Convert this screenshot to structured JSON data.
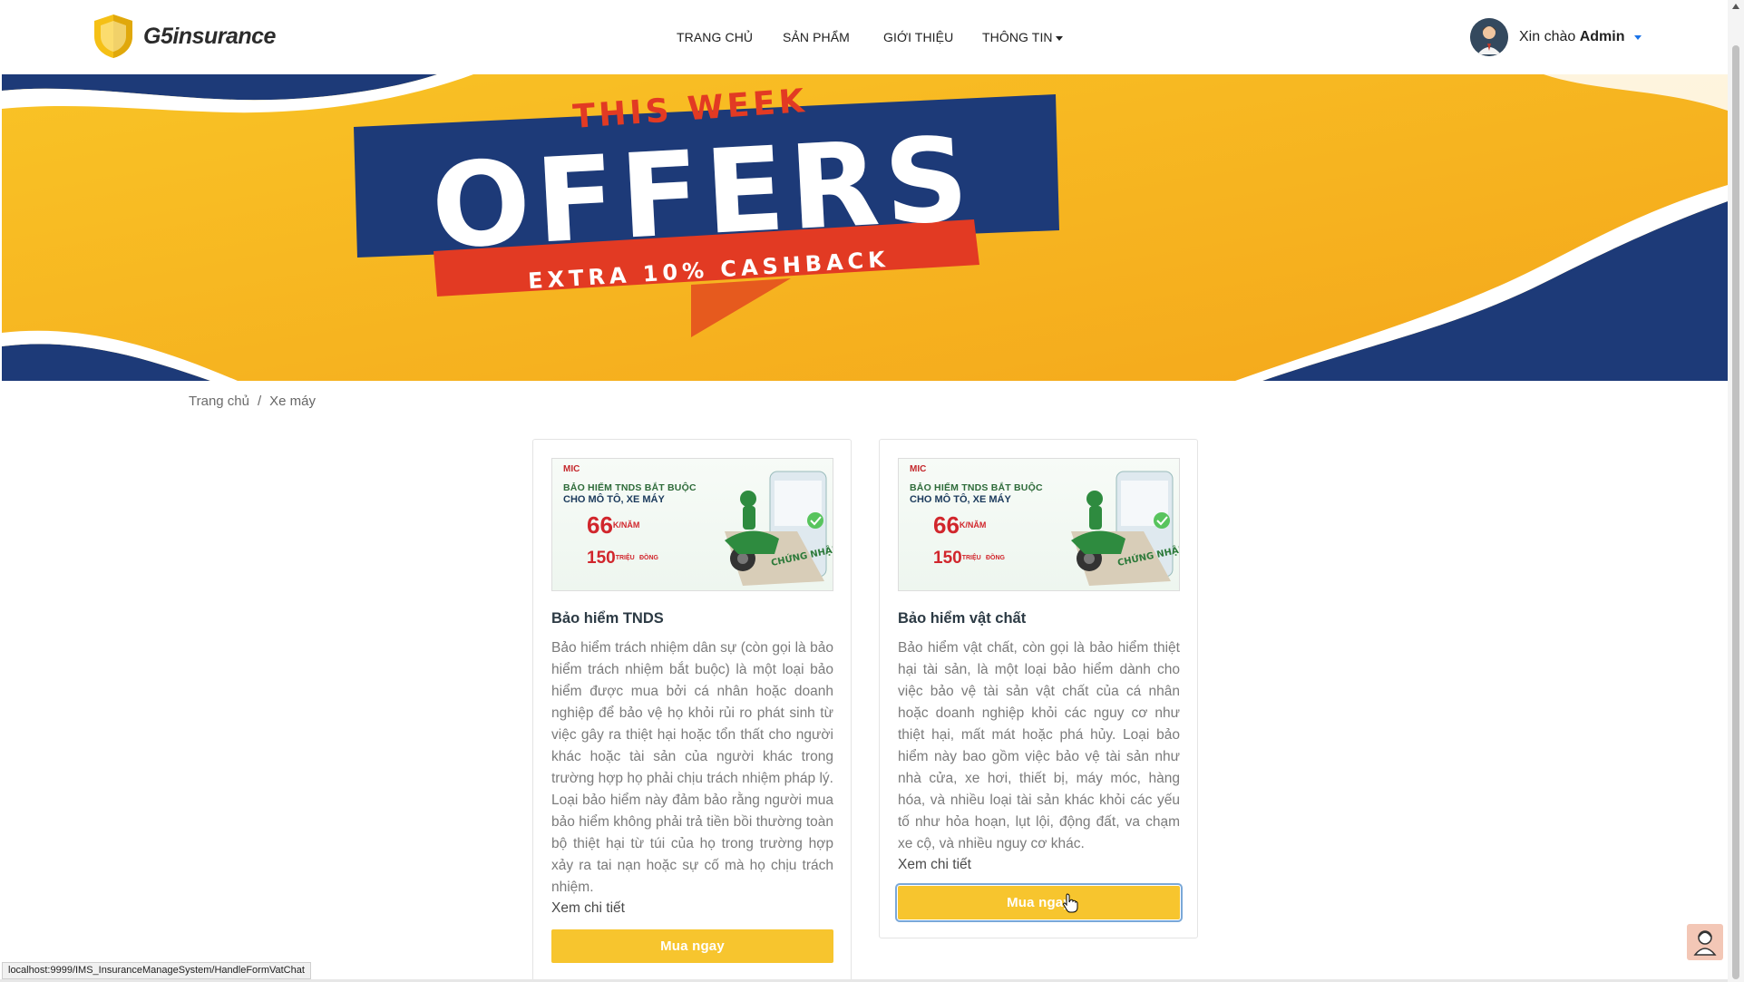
{
  "brand": {
    "name": "G5insurance"
  },
  "nav": {
    "items": [
      {
        "label": "TRANG CHỦ"
      },
      {
        "label": "SẢN PHẨM"
      },
      {
        "label": "GIỚI THIỆU"
      },
      {
        "label": "THÔNG TIN"
      }
    ]
  },
  "user": {
    "greeting": "Xin chào",
    "name": "Admin"
  },
  "banner": {
    "line1": "THIS WEEK",
    "line2": "OFFERS",
    "line3": "EXTRA 10% CASHBACK"
  },
  "breadcrumb": {
    "home": "Trang chủ",
    "separator": "/",
    "current": "Xe máy"
  },
  "cards": [
    {
      "image": {
        "brand": "MIC",
        "line1": "BẢO HIỂM TNDS BẮT BUỘC",
        "line2": "CHO MÔ TÔ, XE MÁY",
        "price": "66",
        "price_unit": "K",
        "price_suffix": "/NĂM",
        "benefit": "150",
        "benefit_unit": "TRIỆU",
        "benefit_suffix": "ĐỒNG",
        "tagline": "CHỨNG NHẬN ĐIỆN TỬ"
      },
      "title": "Bảo hiểm TNDS",
      "description": "Bảo hiểm trách nhiệm dân sự (còn gọi là bảo hiểm trách nhiệm bắt buộc) là một loại bảo hiểm được mua bởi cá nhân hoặc doanh nghiệp để bảo vệ họ khỏi rủi ro phát sinh từ việc gây ra thiệt hại hoặc tổn thất cho người khác hoặc tài sản của người khác trong trường hợp họ phải chịu trách nhiệm pháp lý. Loại bảo hiểm này đảm bảo rằng người mua bảo hiểm không phải trả tiền bồi thường toàn bộ thiệt hại từ túi của họ trong trường hợp xảy ra tai nạn hoặc sự cố mà họ chịu trách nhiệm.",
      "link": "Xem chi tiết",
      "button": "Mua ngay"
    },
    {
      "image": {
        "brand": "MIC",
        "line1": "BẢO HIỂM TNDS BẮT BUỘC",
        "line2": "CHO MÔ TÔ, XE MÁY",
        "price": "66",
        "price_unit": "K",
        "price_suffix": "/NĂM",
        "benefit": "150",
        "benefit_unit": "TRIỆU",
        "benefit_suffix": "ĐỒNG",
        "tagline": "CHỨNG NHẬN ĐIỆN TỬ"
      },
      "title": "Bảo hiểm vật chất",
      "description": "Bảo hiểm vật chất, còn gọi là bảo hiểm thiệt hại tài sản, là một loại bảo hiểm dành cho việc bảo vệ tài sản vật chất của cá nhân hoặc doanh nghiệp khỏi các nguy cơ như thiệt hại, mất mát hoặc phá hủy. Loại bảo hiểm này bao gồm việc bảo vệ tài sản như nhà cửa, xe hơi, thiết bị, máy móc, hàng hóa, và nhiều loại tài sản khác khỏi các yếu tố như hỏa hoạn, lụt lội, động đất, va chạm xe cộ, và nhiều nguy cơ khác.",
      "link": "Xem chi tiết",
      "button": "Mua ngay"
    }
  ],
  "statusbar": {
    "url": "localhost:9999/IMS_InsuranceManageSystem/HandleFormVatChat"
  },
  "colors": {
    "accent": "#f7c52e",
    "banner_navy": "#1d3a78",
    "banner_red": "#e23a23",
    "banner_orange": "#f6a81c"
  }
}
